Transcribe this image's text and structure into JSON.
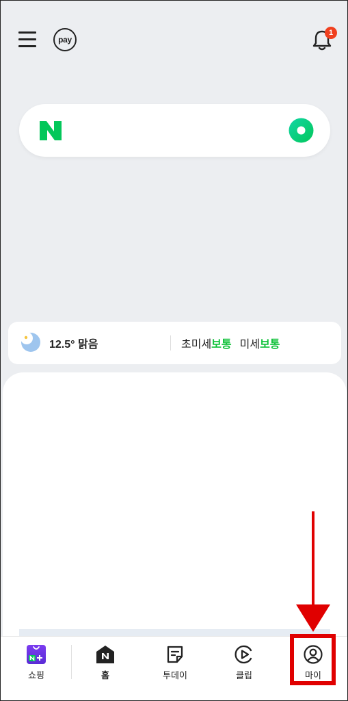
{
  "header": {
    "menu_icon": "hamburger-menu-icon",
    "pay_label": "pay",
    "notification_icon": "bell-icon",
    "notification_count": "1"
  },
  "search": {
    "logo": "naver-n-logo",
    "voice_icon": "green-circle-icon"
  },
  "weather": {
    "icon": "moon-cloud-icon",
    "temperature": "12.5° 맑음",
    "fine_dust_label": "초미세",
    "fine_dust_status": "보통",
    "dust_label": "미세",
    "dust_status": "보통"
  },
  "bottom_nav": {
    "items": [
      {
        "label": "쇼핑",
        "icon": "shopping-bag-icon"
      },
      {
        "label": "홈",
        "icon": "home-icon"
      },
      {
        "label": "투데이",
        "icon": "today-note-icon"
      },
      {
        "label": "클립",
        "icon": "clip-play-icon"
      },
      {
        "label": "마이",
        "icon": "user-profile-icon"
      }
    ]
  },
  "colors": {
    "naver_green": "#03c75a",
    "status_good": "#10c23a",
    "badge_red": "#f0401f",
    "annotation_red": "#e00000",
    "background": "#eceef1"
  }
}
